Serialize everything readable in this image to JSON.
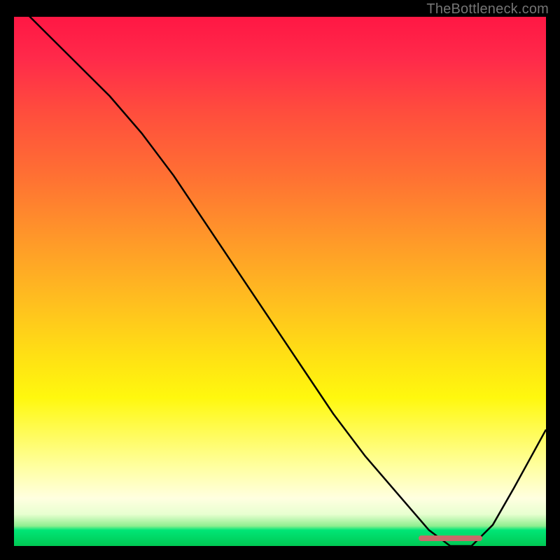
{
  "watermark": "TheBottleneck.com",
  "chart_data": {
    "type": "line",
    "title": "",
    "xlabel": "",
    "ylabel": "",
    "xlim": [
      0,
      100
    ],
    "ylim": [
      0,
      100
    ],
    "grid": false,
    "series": [
      {
        "name": "bottleneck-curve",
        "x": [
          0,
          6,
          12,
          18,
          24,
          30,
          36,
          42,
          48,
          54,
          60,
          66,
          72,
          78,
          82,
          86,
          90,
          94,
          100
        ],
        "values": [
          103,
          97,
          91,
          85,
          78,
          70,
          61,
          52,
          43,
          34,
          25,
          17,
          10,
          3,
          0,
          0,
          4,
          11,
          22
        ]
      }
    ],
    "optimal_range": {
      "x_start": 76,
      "x_end": 88,
      "y": 1.5
    },
    "background_gradient": {
      "top": "#ff1744",
      "mid": "#ffe014",
      "bottom": "#00c853"
    }
  }
}
